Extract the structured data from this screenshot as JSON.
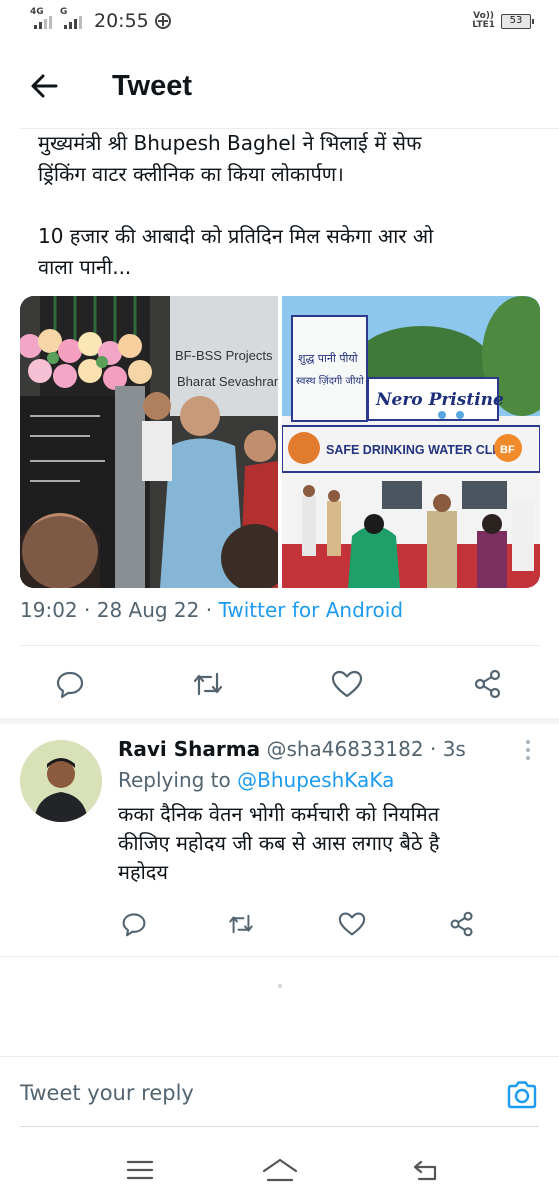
{
  "status_bar": {
    "network_1": "4G",
    "network_2": "G",
    "time": "20:55",
    "volte": "Vo))\nLTE1",
    "battery": "53"
  },
  "header": {
    "title": "Tweet",
    "back_icon": "arrow-left-icon"
  },
  "tweet": {
    "text_lines": [
      "मुख्यमंत्री श्री Bhupesh Baghel  ने भिलाई में सेफ",
      "ड्रिंकिंग वाटर क्लीनिक का किया लोकार्पण।",
      "10 हजार की आबादी को प्रतिदिन मिल सकेगा आर ओ",
      "वाला पानी..."
    ],
    "photo_left_text": {
      "sign_line1": "BF-BSS Projects",
      "sign_line2": "Bharat Sevashram"
    },
    "photo_right_text": {
      "hindi_line1": "शुद्ध पानी पीयो",
      "hindi_line2": "स्वस्थ ज़िंदगी जीयो",
      "brand": "Nero Pristine",
      "banner": "SAFE DRINKING WATER CLINIC",
      "logo": "BF"
    },
    "time": "19:02",
    "date": "28 Aug 22",
    "dot": "·",
    "source": "Twitter for Android",
    "actions": [
      "reply-icon",
      "retweet-icon",
      "like-icon",
      "share-icon"
    ]
  },
  "reply": {
    "name": "Ravi Sharma",
    "handle": "@sha46833182",
    "dot": "·",
    "time": "3s",
    "replying_prefix": "Replying to",
    "replying_to": "@BhupeshKaKa",
    "text_lines": [
      "कका दैनिक वेतन भोगी कर्मचारी को नियमित",
      "कीजिए महोदय जी कब से आस लगाए बैठे है",
      "महोदय"
    ],
    "actions": [
      "reply-icon",
      "retweet-icon",
      "like-icon",
      "share-icon"
    ]
  },
  "compose": {
    "placeholder": "Tweet your reply",
    "camera_icon": "camera-icon"
  },
  "colors": {
    "accent": "#1d9bf0",
    "text": "#0f1419",
    "muted": "#536471"
  },
  "navbar": {
    "icons": [
      "menu-icon",
      "home-icon",
      "back-icon"
    ]
  }
}
